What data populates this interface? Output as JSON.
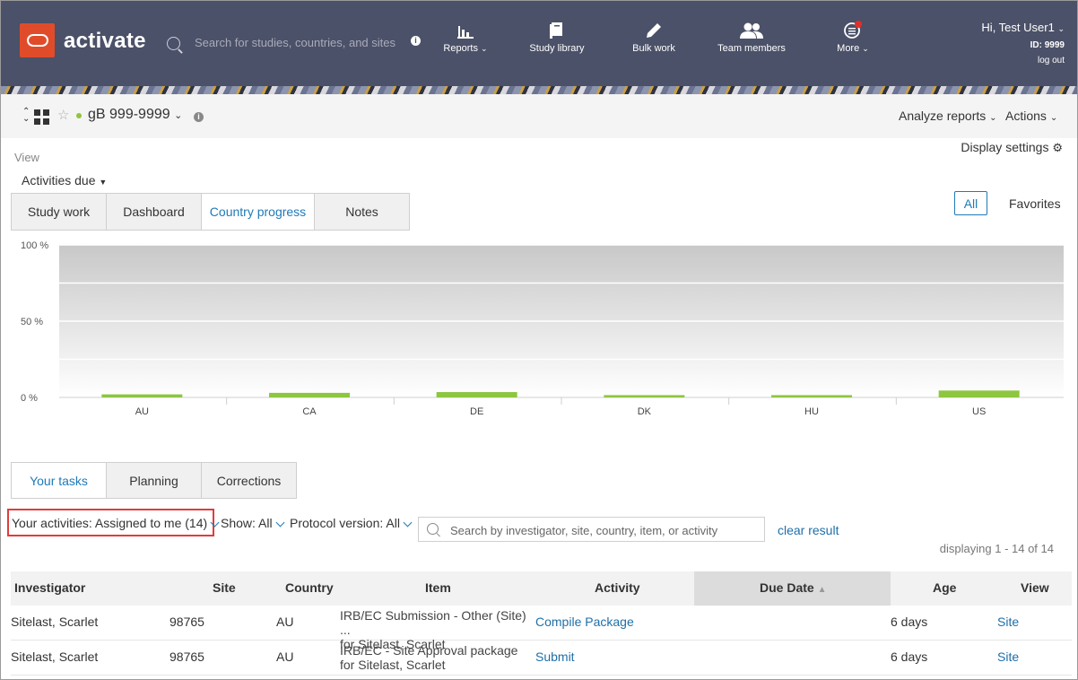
{
  "header": {
    "brand": "activate",
    "search_placeholder": "Search for studies, countries, and sites",
    "nav": [
      {
        "label": "Reports",
        "icon": "bar-chart-icon",
        "has_dropdown": true
      },
      {
        "label": "Study library",
        "icon": "book-icon",
        "has_dropdown": false
      },
      {
        "label": "Bulk work",
        "icon": "pencil-icon",
        "has_dropdown": false
      },
      {
        "label": "Team members",
        "icon": "users-icon",
        "has_dropdown": false
      },
      {
        "label": "More",
        "icon": "list-alert-icon",
        "has_dropdown": true
      }
    ],
    "user": {
      "greeting": "Hi, Test User1",
      "id": "ID: 9999",
      "logout": "log out"
    }
  },
  "studybar": {
    "study_name": "gB 999-9999",
    "analyze_reports": "Analyze reports",
    "actions": "Actions"
  },
  "view": {
    "label": "View",
    "display_settings": "Display settings",
    "selector": "Activities due",
    "tabs": [
      {
        "label": "Study work",
        "active": false
      },
      {
        "label": "Dashboard",
        "active": false
      },
      {
        "label": "Country progress",
        "active": true
      },
      {
        "label": "Notes",
        "active": false
      }
    ],
    "filter_all": "All",
    "filter_favorites": "Favorites"
  },
  "chart_data": {
    "type": "bar",
    "categories": [
      "AU",
      "CA",
      "DE",
      "DK",
      "HU",
      "US"
    ],
    "values": [
      2,
      3,
      3.5,
      1.5,
      1.5,
      4.5
    ],
    "ylim": [
      0,
      100
    ],
    "yticks": [
      "0 %",
      "50 %",
      "100 %"
    ],
    "bar_color": "#8dc63f",
    "grid": true,
    "title": "",
    "xlabel": "",
    "ylabel": ""
  },
  "tasks": {
    "tabs": [
      {
        "label": "Your tasks",
        "active": true
      },
      {
        "label": "Planning",
        "active": false
      },
      {
        "label": "Corrections",
        "active": false
      }
    ],
    "filters": {
      "your_activities": "Your activities: Assigned to me (14)",
      "show": "Show: All",
      "protocol_version": "Protocol version: All"
    },
    "search_placeholder": "Search by investigator, site, country, item, or activity",
    "clear_result": "clear result",
    "displaying": "displaying 1 - 14 of 14",
    "columns": {
      "investigator": "Investigator",
      "site": "Site",
      "country": "Country",
      "item": "Item",
      "activity": "Activity",
      "due_date": "Due Date",
      "age": "Age",
      "view": "View"
    },
    "rows": [
      {
        "investigator": "Sitelast, Scarlet",
        "site": "98765",
        "country": "AU",
        "item_line1": "IRB/EC Submission - Other (Site) ...",
        "item_line2": "for Sitelast, Scarlet",
        "activity": "Compile Package",
        "due_date": "",
        "age": "6 days",
        "view": "Site"
      },
      {
        "investigator": "Sitelast, Scarlet",
        "site": "98765",
        "country": "AU",
        "item_line1": "IRB/EC - Site Approval package",
        "item_line2": "for Sitelast, Scarlet",
        "activity": "Submit",
        "due_date": "",
        "age": "6 days",
        "view": "Site"
      }
    ]
  }
}
